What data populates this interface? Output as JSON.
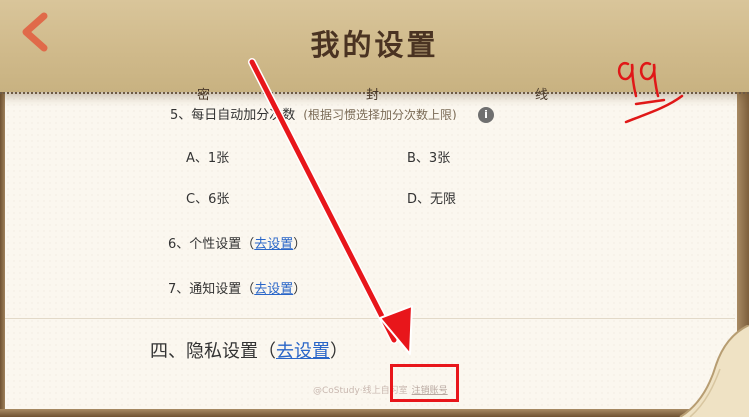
{
  "header": {
    "title": "我的设置",
    "back_icon": "chevron-left-icon",
    "seal_chars": [
      "密",
      "封",
      "线"
    ]
  },
  "annotation": {
    "handwritten_score": "99"
  },
  "question": {
    "cut_text": "5、每日自动加分次数",
    "hint": "(根据习惯选择加分次数上限)",
    "options": [
      {
        "label": "A、1张"
      },
      {
        "label": "B、3张"
      },
      {
        "label": "C、6张"
      },
      {
        "label": "D、无限"
      }
    ]
  },
  "settings": [
    {
      "label": "6、个性设置（",
      "link": "去设置",
      "close": "）"
    },
    {
      "label": "7、通知设置（",
      "link": "去设置",
      "close": "）"
    }
  ],
  "privacy": {
    "label": "四、隐私设置（",
    "link": "去设置",
    "close": "）"
  },
  "footer": {
    "credit": "@CoStudy·线上自习室",
    "logout": "注销账号"
  },
  "colors": {
    "header_bg": "#d3bf92",
    "accent_red": "#e8161b",
    "link_blue": "#2a66c8",
    "back_icon": "#e06a4a"
  }
}
